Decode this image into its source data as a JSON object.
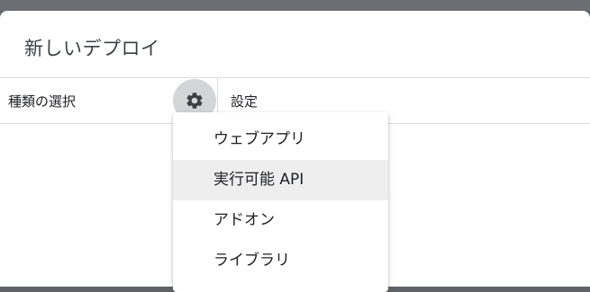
{
  "dialog": {
    "title": "新しいデプロイ"
  },
  "header": {
    "type_label": "種類の選択",
    "settings_label": "設定"
  },
  "menu": {
    "items": [
      {
        "label": "ウェブアプリ"
      },
      {
        "label": "実行可能 API",
        "hovered": true
      },
      {
        "label": "アドオン"
      },
      {
        "label": "ライブラリ"
      }
    ]
  },
  "icons": {
    "gear": "gear-icon"
  },
  "colors": {
    "backdrop": "#5f6368",
    "gear_button_bg": "#d4d5d7",
    "hover_bg": "#eeeeee"
  }
}
